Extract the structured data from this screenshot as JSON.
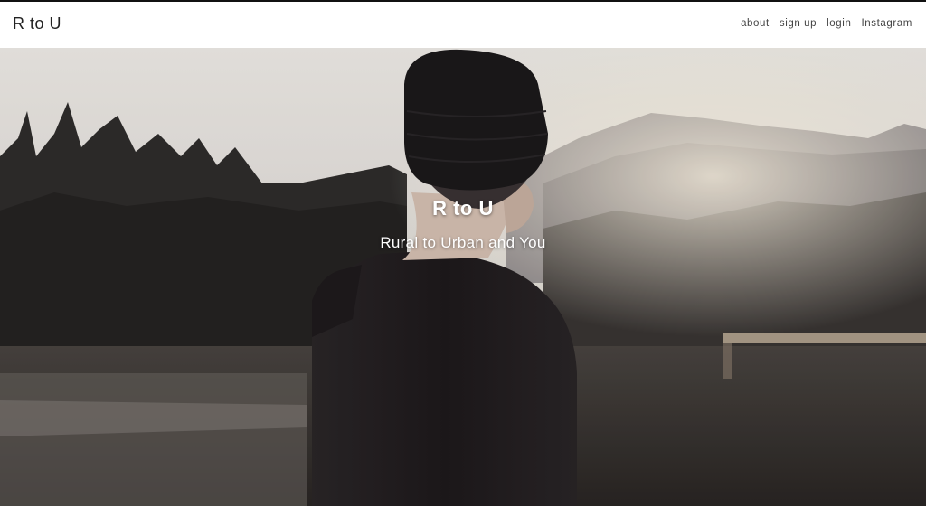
{
  "header": {
    "brand": "R to U",
    "nav": [
      "about",
      "sign up",
      "login",
      "Instagram"
    ]
  },
  "hero": {
    "title": "R to U",
    "subtitle": "Rural to Urban and You"
  }
}
